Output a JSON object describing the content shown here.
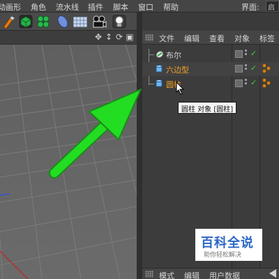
{
  "menu": {
    "items": [
      "动画形",
      "角色",
      "流水线",
      "插件",
      "脚本",
      "窗口",
      "帮助"
    ],
    "interface_label": "界面:",
    "interface_value": "启"
  },
  "toolbar": {
    "icons": [
      "pen-tool-icon",
      "cube-icon",
      "cloner-icon",
      "deformer-icon",
      "floor-icon",
      "camera-icon",
      "light-icon"
    ]
  },
  "viewport": {
    "nav_icons": [
      "move-view-icon",
      "zoom-view-icon",
      "rotate-view-icon",
      "maximize-view-icon"
    ],
    "nav_glyphs": [
      "✥",
      "↕",
      "⟳",
      "▣"
    ]
  },
  "object_manager": {
    "tabs": [
      "文件",
      "编辑",
      "查看",
      "对象",
      "标签"
    ],
    "objects": [
      {
        "name": "布尔",
        "color": "white",
        "icon": "boole-icon"
      },
      {
        "name": "六边型",
        "color": "orange",
        "icon": "cylinder-icon"
      },
      {
        "name": "圆柱",
        "color": "orange",
        "icon": "cylinder-icon"
      }
    ],
    "check_glyph": "✓"
  },
  "tooltip": {
    "text": "圆柱 对象 [圆柱]"
  },
  "attributes": {
    "tabs": [
      "模式",
      "编辑",
      "用户数据"
    ]
  },
  "watermark": {
    "title": "百科全说",
    "subtitle": "助你轻松解决"
  },
  "colors": {
    "accent_orange": "#f0a020",
    "check_green": "#44cc44",
    "arrow_green": "#22dd22",
    "watermark_blue": "#2a66c6"
  }
}
